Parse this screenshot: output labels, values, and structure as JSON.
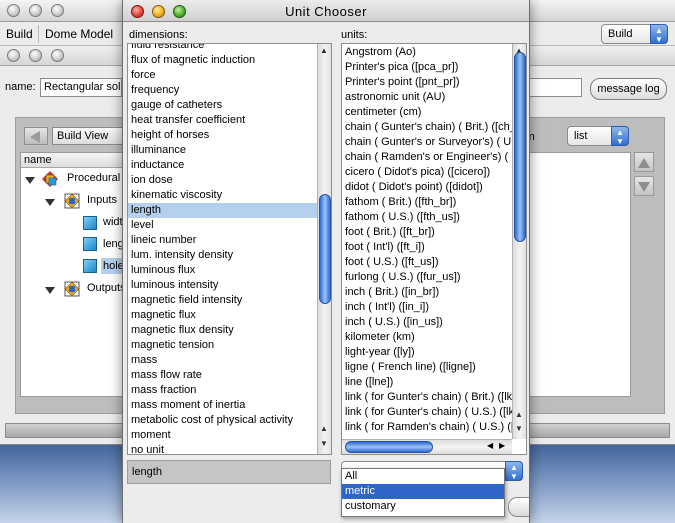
{
  "background_window": {
    "menu": [
      "Build",
      "Dome Model"
    ],
    "mode_select": "Build",
    "name_label": "name:",
    "name_value": "Rectangular soli",
    "message_log_button": "message log",
    "view_select": "Build View",
    "tree_header": "name",
    "tree_items": [
      {
        "label": "Procedural",
        "icon": "procedural-icon"
      },
      {
        "label": "Inputs",
        "icon": "inputs-icon"
      },
      {
        "label": "widt",
        "icon": "cube-icon"
      },
      {
        "label": "leng",
        "icon": "cube-icon"
      },
      {
        "label": "hole",
        "icon": "cube-icon"
      },
      {
        "label": "Outputs",
        "icon": "outputs-icon"
      }
    ],
    "right_label": "ization",
    "list_select": "list"
  },
  "dialog": {
    "title": "Unit Chooser",
    "dimensions_label": "dimensions:",
    "units_label": "units:",
    "dimensions": [
      "fluid resistance",
      "flux of magnetic induction",
      "force",
      "frequency",
      "gauge of catheters",
      "heat transfer coefficient",
      "height of horses",
      "illuminance",
      "inductance",
      "ion dose",
      "kinematic viscosity",
      "length",
      "level",
      "lineic number",
      "lum. intensity density",
      "luminous flux",
      "luminous intensity",
      "magnetic field intensity",
      "magnetic flux",
      "magnetic flux density",
      "magnetic tension",
      "mass",
      "mass flow rate",
      "mass fraction",
      "mass moment of inertia",
      "metabolic cost of physical activity",
      "moment",
      "no unit"
    ],
    "selected_dimension": "length",
    "units": [
      "Angstrom    (Ao)",
      "Printer's pica    ([pca_pr])",
      "Printer's point    ([pnt_pr])",
      "astronomic unit    (AU)",
      "centimeter    (cm)",
      "chain ( Gunter's chain) ( Brit.)    ([ch_br])",
      "chain ( Gunter's or Surveyor's) ( U.S.)",
      "chain ( Ramden's or Engineer's) ( U.S.)",
      "cicero ( Didot's pica)    ([cicero])",
      "didot ( Didot's point)    ([didot])",
      "fathom ( Brit.)    ([fth_br])",
      "fathom ( U.S.)    ([fth_us])",
      "foot ( Brit.)    ([ft_br])",
      "foot ( Int'l)    ([ft_i])",
      "foot ( U.S.)    ([ft_us])",
      "furlong ( U.S.)    ([fur_us])",
      "inch ( Brit.)    ([in_br])",
      "inch ( Int'l)    ([in_i])",
      "inch ( U.S.)    ([in_us])",
      "kilometer    (km)",
      "light-year    ([ly])",
      "ligne ( French line)    ([ligne])",
      "line    ([lne])",
      "link ( for Gunter's chain) ( Brit.)    ([lk_br])",
      "link ( for Gunter's chain) ( U.S.)    ([lk_us])",
      "link ( for Ramden's chain) ( U.S.)    ([rlk_us])"
    ],
    "dimension_value": "length",
    "filter_options": [
      "All",
      "metric",
      "customary"
    ],
    "filter_highlighted": "metric"
  },
  "colors": {
    "selection": "#b5cfee",
    "menu_highlight": "#2f64c9",
    "scroll_thumb": "#2e6ad0"
  }
}
